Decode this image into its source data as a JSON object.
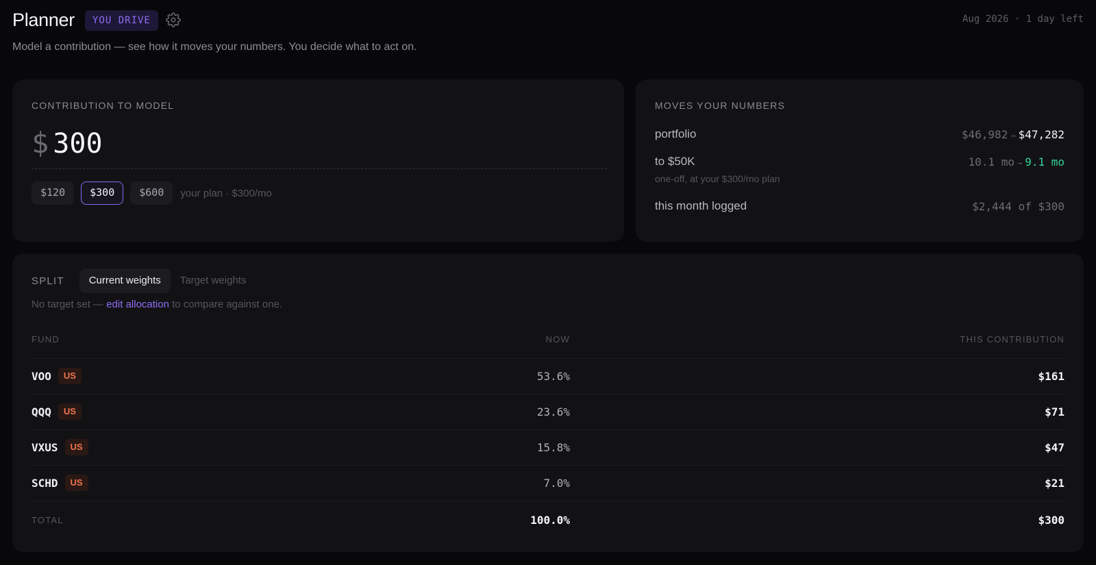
{
  "header": {
    "title": "Planner",
    "mode_badge": "YOU DRIVE",
    "settings_icon": "gear-icon",
    "deadline": "Aug 2026 · 1 day left",
    "subtitle": "Model a contribution — see how it moves your numbers. You decide what to act on."
  },
  "contribution": {
    "heading": "CONTRIBUTION TO MODEL",
    "currency": "$",
    "amount": "300",
    "presets": [
      "$120",
      "$300",
      "$600"
    ],
    "selected_preset": "$300",
    "plan_note": "your plan · $300/mo"
  },
  "moves": {
    "heading": "MOVES YOUR NUMBERS",
    "portfolio": {
      "label": "portfolio",
      "from": "$46,982",
      "to": "$47,282"
    },
    "to_goal": {
      "label": "to $50K",
      "from": "10.1 mo",
      "to": "9.1 mo",
      "note": "one-off, at your $300/mo plan"
    },
    "logged": {
      "label": "this month logged",
      "value": "$2,444 of $300"
    },
    "arrow": "→"
  },
  "split": {
    "heading": "SPLIT",
    "tabs": [
      "Current weights",
      "Target weights"
    ],
    "active_tab": "Current weights",
    "note_before": "No target set — ",
    "note_link": "edit allocation",
    "note_after": " to compare against one.",
    "columns": {
      "fund": "FUND",
      "now": "NOW",
      "contribution": "THIS CONTRIBUTION"
    },
    "rows": [
      {
        "ticker": "VOO",
        "region": "US",
        "now": "53.6%",
        "contribution": "$161"
      },
      {
        "ticker": "QQQ",
        "region": "US",
        "now": "23.6%",
        "contribution": "$71"
      },
      {
        "ticker": "VXUS",
        "region": "US",
        "now": "15.8%",
        "contribution": "$47"
      },
      {
        "ticker": "SCHD",
        "region": "US",
        "now": "7.0%",
        "contribution": "$21"
      }
    ],
    "total": {
      "label": "TOTAL",
      "now": "100.0%",
      "contribution": "$300"
    }
  },
  "colors": {
    "accent": "#8b6af2",
    "positive": "#34d399",
    "region_tag": "#f0764f",
    "background": "#08080a",
    "card": "#121215"
  }
}
